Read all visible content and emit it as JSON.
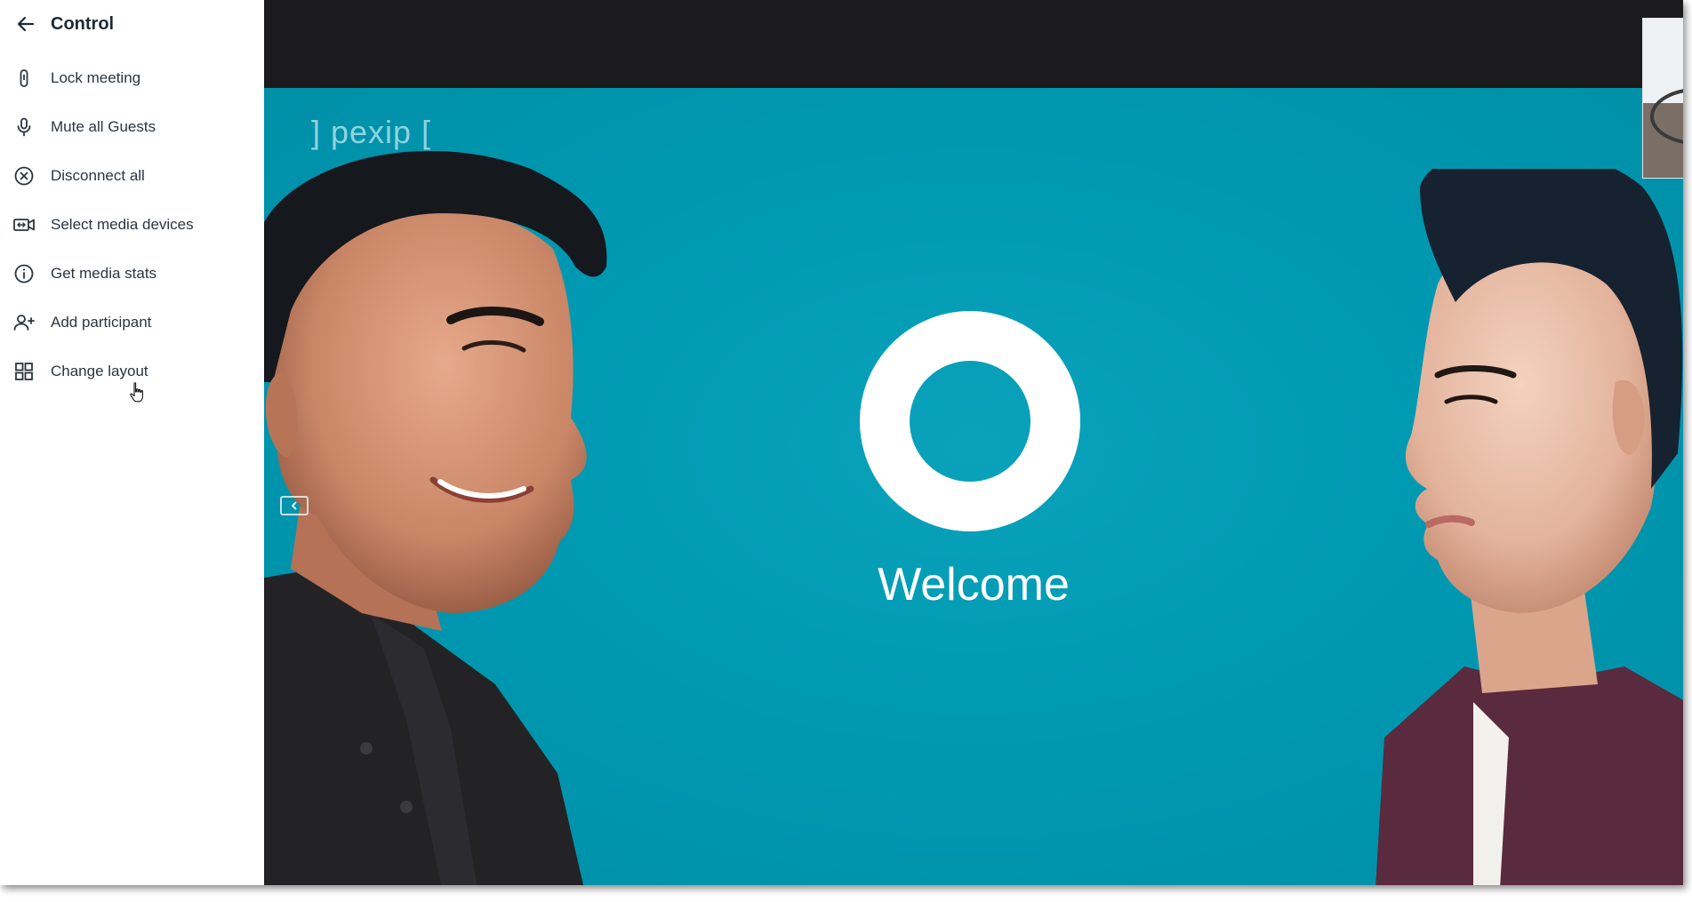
{
  "sidebar": {
    "title": "Control",
    "back_icon": "arrow-left-icon",
    "items": [
      {
        "label": "Lock meeting",
        "icon": "lock-icon"
      },
      {
        "label": "Mute all Guests",
        "icon": "microphone-icon"
      },
      {
        "label": "Disconnect all",
        "icon": "close-circle-icon"
      },
      {
        "label": "Select media devices",
        "icon": "video-settings-icon"
      },
      {
        "label": "Get media stats",
        "icon": "info-icon"
      },
      {
        "label": "Add participant",
        "icon": "add-user-icon"
      },
      {
        "label": "Change layout",
        "icon": "grid-layout-icon"
      }
    ]
  },
  "stage": {
    "brand": "] pexip [",
    "welcome_text": "Welcome",
    "colors": {
      "background": "#0097b0",
      "topbar": "#1b1b1d",
      "ring": "#ffffff"
    }
  }
}
